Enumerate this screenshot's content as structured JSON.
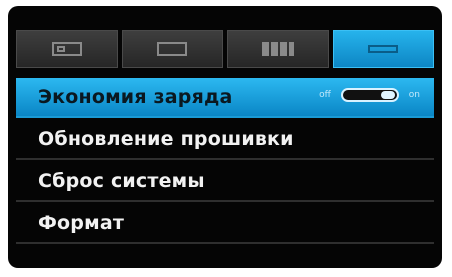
{
  "tabs": [
    {
      "icon": "camera-icon",
      "active": false
    },
    {
      "icon": "video-frame-icon",
      "active": false
    },
    {
      "icon": "grid-icon",
      "active": false
    },
    {
      "icon": "settings-icon",
      "active": true
    }
  ],
  "menu": {
    "items": [
      {
        "label": "Экономия заряда",
        "selected": true
      },
      {
        "label": "Обновление прошивки",
        "selected": false
      },
      {
        "label": "Сброс системы",
        "selected": false
      },
      {
        "label": "Формат",
        "selected": false
      }
    ],
    "toggle": {
      "off_text": "off",
      "on_text": "on",
      "state": "on"
    }
  },
  "colors": {
    "accent": "#1ea5e3",
    "background": "#050505"
  }
}
